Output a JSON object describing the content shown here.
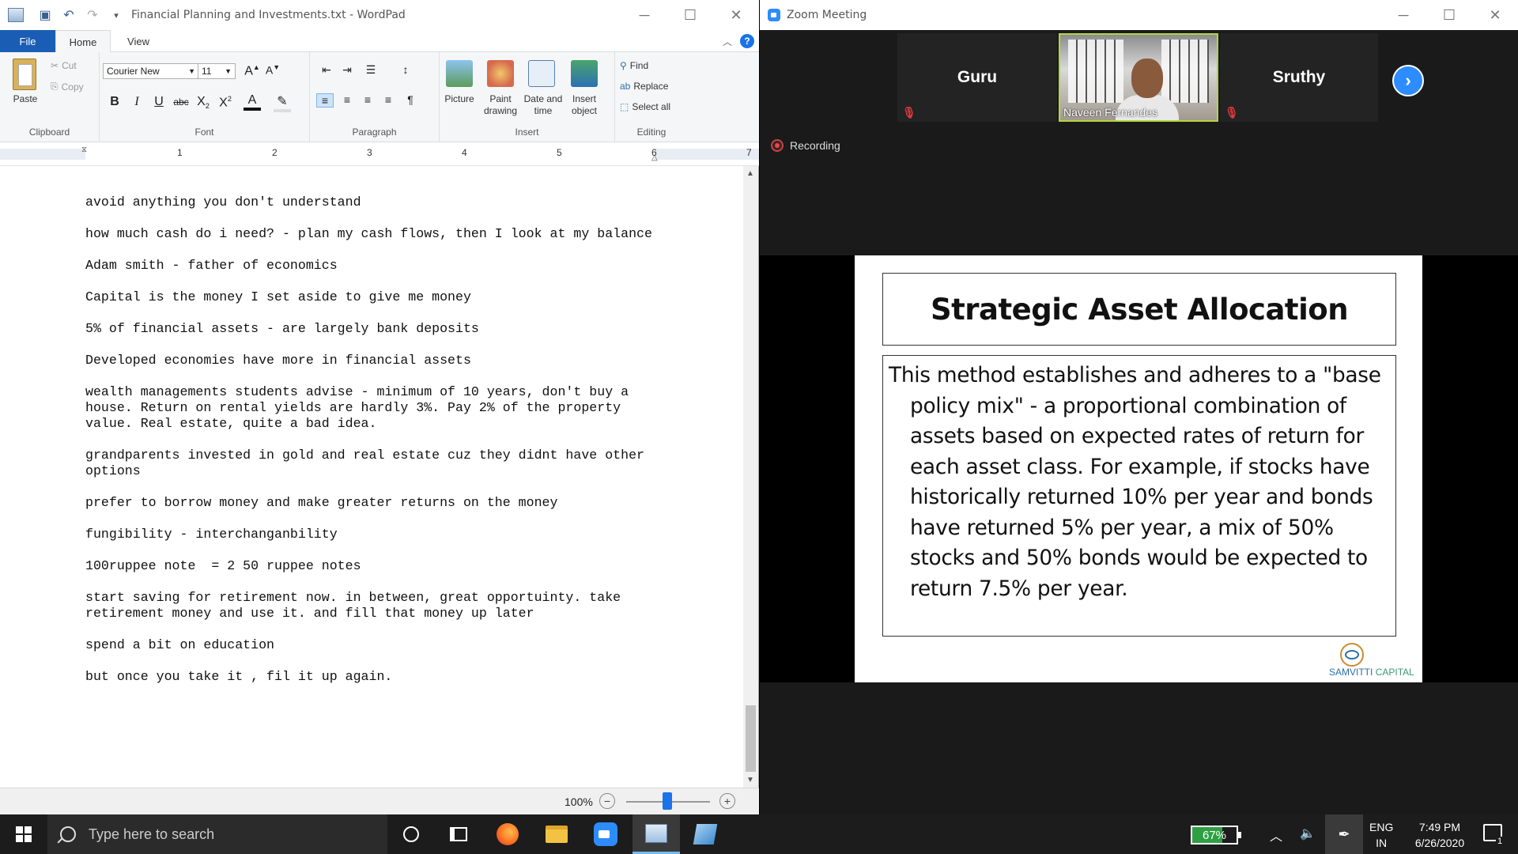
{
  "wordpad": {
    "title": "Financial Planning and Investments.txt - WordPad",
    "tabs": [
      "File",
      "Home",
      "View"
    ],
    "clipboard": {
      "paste": "Paste",
      "cut": "Cut",
      "copy": "Copy",
      "group": "Clipboard"
    },
    "font": {
      "family": "Courier New",
      "size": "11",
      "group": "Font"
    },
    "paragraph_group": "Paragraph",
    "insert": {
      "picture": "Picture",
      "paint": "Paint drawing",
      "datetime": "Date and time",
      "object": "Insert object",
      "group": "Insert"
    },
    "editing": {
      "find": "Find",
      "replace": "Replace",
      "select_all": "Select all",
      "group": "Editing"
    },
    "ruler_numbers": [
      "1",
      "2",
      "3",
      "4",
      "5",
      "6",
      "7"
    ],
    "zoom": "100%",
    "paragraphs": [
      "avoid anything you don't understand",
      "how much cash do i need? - plan my cash flows, then I look at my balance",
      "Adam smith - father of economics",
      "Capital is the money I set aside to give me money",
      "5% of financial assets - are largely bank deposits",
      "Developed economies have more in financial assets",
      "wealth managements students advise - minimum of 10 years, don't buy a house. Return on rental yields are hardly 3%. Pay 2% of the property value. Real estate, quite a bad idea.",
      "grandparents invested in gold and real estate cuz they didnt have other options",
      "prefer to borrow money and make greater returns on the money",
      "fungibility - interchanganbility",
      "100ruppee note  = 2 50 ruppee notes",
      "start saving for retirement now. in between, great opportuinty. take retirement money and use it. and fill that money up later",
      "spend a bit on education",
      "but once you take it , fil it up again."
    ]
  },
  "zoom": {
    "title": "Zoom Meeting",
    "participants": {
      "left": "Guru",
      "center": "Naveen Fernandes",
      "right": "Sruthy"
    },
    "recording": "Recording",
    "slide": {
      "title": "Strategic Asset Allocation",
      "body": "This method establishes and adheres to a \"base policy mix\" - a proportional combination of assets based on expected rates of return for each asset class. For example, if stocks have historically returned 10% per year and bonds have returned 5% per year, a mix of 50% stocks and 50% bonds would be expected to return 7.5% per year.",
      "brand_a": "SAMVITTI",
      "brand_b": "CAPITAL"
    }
  },
  "taskbar": {
    "search_placeholder": "Type here to search",
    "battery": "67%",
    "lang_1": "ENG",
    "lang_2": "IN",
    "time": "7:49 PM",
    "date": "6/26/2020",
    "notifications": "1"
  }
}
